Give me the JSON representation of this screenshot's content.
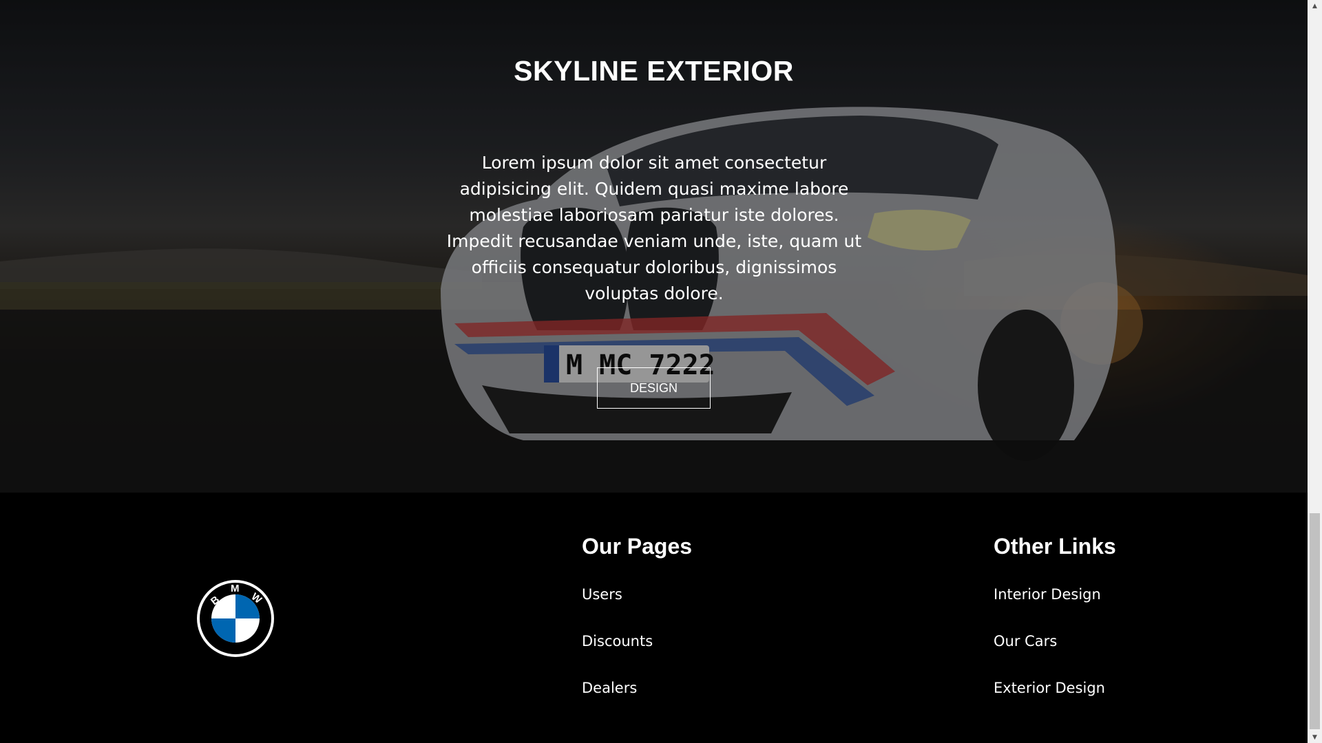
{
  "hero": {
    "title": "SKYLINE EXTERIOR",
    "paragraph": "Lorem ipsum dolor sit amet consectetur adipisicing elit. Quidem quasi maxime labore molestiae laboriosam pariatur iste dolores. Impedit recusandae veniam unde, iste, quam ut officiis consequatur doloribus, dignissimos voluptas dolore.",
    "button_label": "DESIGN",
    "license_plate": "M MC 7222"
  },
  "footer": {
    "logo_letters": "BMW",
    "our_pages": {
      "heading": "Our Pages",
      "items": [
        "Users",
        "Discounts",
        "Dealers"
      ]
    },
    "other_links": {
      "heading": "Other Links",
      "items": [
        "Interior Design",
        "Our Cars",
        "Exterior Design"
      ]
    }
  },
  "colors": {
    "footer_bg": "#000000",
    "brand_blue": "#0066b1",
    "text": "#ffffff"
  },
  "icons": {
    "logo": "bmw-roundel-icon",
    "scroll_up": "chevron-up-icon",
    "scroll_down": "chevron-down-icon"
  }
}
